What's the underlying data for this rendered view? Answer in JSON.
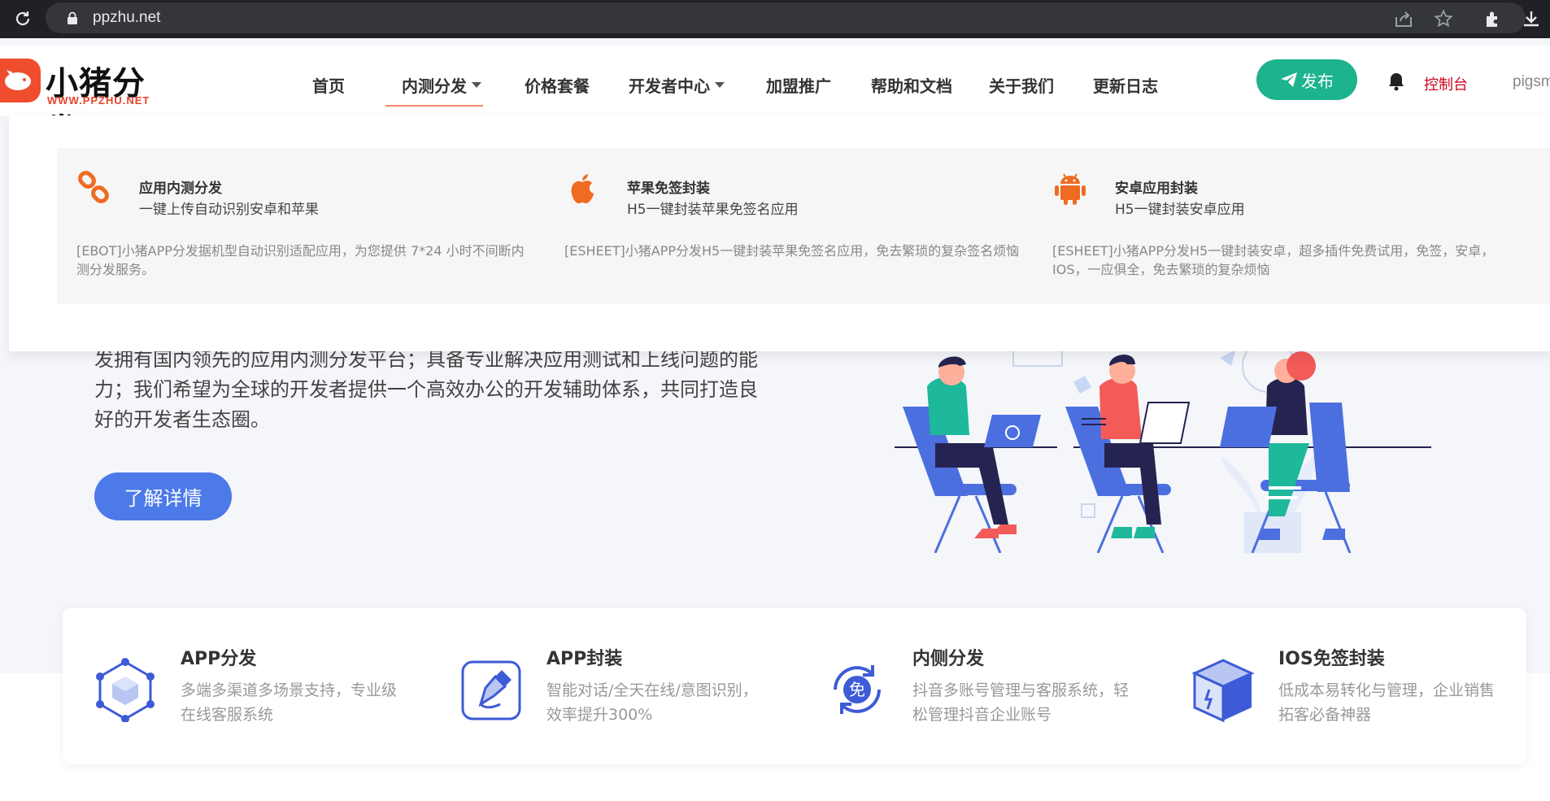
{
  "browser": {
    "url": "ppzhu.net"
  },
  "header": {
    "logo_title": "小猪分发",
    "logo_sub": "WWW.PPZHU.NET",
    "nav": [
      {
        "label": "首页"
      },
      {
        "label": "内测分发"
      },
      {
        "label": "价格套餐"
      },
      {
        "label": "开发者中心"
      },
      {
        "label": "加盟推广"
      },
      {
        "label": "帮助和文档"
      },
      {
        "label": "关于我们"
      },
      {
        "label": "更新日志"
      }
    ],
    "publish_label": "发布",
    "console_label": "控制台",
    "user_label": "pigsm"
  },
  "dropdown": {
    "items": [
      {
        "title": "应用内测分发",
        "subtitle": "一键上传自动识别安卓和苹果",
        "desc": "[EBOT]小猪APP分发据机型自动识别适配应用，为您提供 7*24 小时不间断内测分发服务。"
      },
      {
        "title": "苹果免签封装",
        "subtitle": "H5一键封装苹果免签名应用",
        "desc": "[ESHEET]小猪APP分发H5一键封装苹果免签名应用，免去繁琐的复杂签名烦恼"
      },
      {
        "title": "安卓应用封装",
        "subtitle": "H5一键封装安卓应用",
        "desc": "[ESHEET]小猪APP分发H5一键封装安卓，超多插件免费试用，免签，安卓，IOS，一应俱全，免去繁琐的复杂烦恼"
      }
    ]
  },
  "hero": {
    "text": "发拥有国内领先的应用内测分发平台；具备专业解决应用测试和上线问题的能力；我们希望为全球的开发者提供一个高效办公的开发辅助体系，共同打造良好的开发者生态圈。",
    "button_label": "了解详情"
  },
  "features": [
    {
      "title": "APP分发",
      "desc": "多端多渠道多场景支持，专业级在线客服系统",
      "icon": "cube-network-icon"
    },
    {
      "title": "APP封装",
      "desc": "智能对话/全天在线/意图识别，效率提升300%",
      "icon": "pen-box-icon"
    },
    {
      "title": "内侧分发",
      "desc": "抖音多账号管理与客服系统，轻松管理抖音企业账号",
      "icon": "free-cycle-icon"
    },
    {
      "title": "IOS免签封装",
      "desc": "低成本易转化与管理，企业销售拓客必备神器",
      "icon": "package-box-icon"
    }
  ],
  "colors": {
    "accent_green": "#1db38f",
    "accent_blue": "#4c7ae8",
    "logo_red": "#ef4d2d",
    "dropdown_icon_orange": "#ef6b22",
    "console_red": "#d0021b"
  }
}
